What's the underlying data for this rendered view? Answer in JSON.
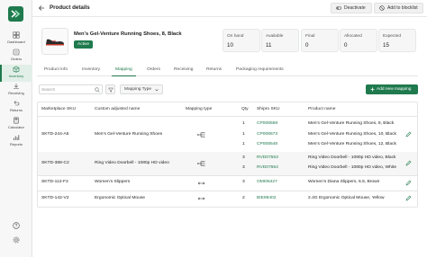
{
  "sidebar": {
    "items": [
      {
        "label": "Dashboard",
        "icon": "dashboard-icon"
      },
      {
        "label": "Orders",
        "icon": "orders-icon"
      },
      {
        "label": "Inventory",
        "icon": "inventory-icon"
      },
      {
        "label": "Receiving",
        "icon": "receiving-icon"
      },
      {
        "label": "Returns",
        "icon": "returns-icon"
      },
      {
        "label": "Calculator",
        "icon": "calculator-icon"
      },
      {
        "label": "Reports",
        "icon": "reports-icon"
      }
    ],
    "active": "Inventory"
  },
  "header": {
    "title": "Product details",
    "deactivate_label": "Deactivate",
    "blocklist_label": "Add to blocklist"
  },
  "product": {
    "name": "Men's Gel-Venture Running Shoes, 8, Black",
    "status": "Active"
  },
  "stats": [
    {
      "label": "On hand",
      "value": "10"
    },
    {
      "label": "Available",
      "value": "11"
    },
    {
      "label": "Final",
      "value": "0"
    },
    {
      "label": "Allocated",
      "value": "0"
    },
    {
      "label": "Expected",
      "value": "15"
    }
  ],
  "tabs": [
    "Product info",
    "Inventory",
    "Mapping",
    "Orders",
    "Receiving",
    "Returns",
    "Packaging requirements"
  ],
  "active_tab": "Mapping",
  "filters": {
    "search_placeholder": "Search",
    "mapping_type_label": "Mapping Type",
    "add_mapping_label": "Add new mapping"
  },
  "table": {
    "columns": [
      "Marketplace SKU",
      "Custom adjusted name",
      "Mapping type",
      "Qty",
      "Shipro SKU",
      "Product name"
    ],
    "groups": [
      {
        "marketplace_sku": "SKTD-244-A5",
        "custom_name": "Men's Gel-Venture Running Shoes",
        "mapping_type": "one-to-many",
        "lines": [
          {
            "qty": "1",
            "sku": "CP008558",
            "product": "Men's Gel-Venture Running Shoes, 8, Black"
          },
          {
            "qty": "1",
            "sku": "CP008573",
            "product": "Men's Gel-Venture Running Shoes, 10, Black"
          },
          {
            "qty": "1",
            "sku": "CP008548",
            "product": "Men's Gel-Venture Running Shoes, 12, Black"
          }
        ]
      },
      {
        "marketplace_sku": "SKTD-388-C2",
        "custom_name": "Ring Video Doorbell - 1080p HD video",
        "mapping_type": "one-to-many",
        "lines": [
          {
            "qty": "3",
            "sku": "RVD07553",
            "product": "Ring Video Doorbell - 1080p HD video, Black"
          },
          {
            "qty": "3",
            "sku": "RVD07554",
            "product": "Ring Video Doorbell - 1080p HD video, White"
          }
        ]
      },
      {
        "marketplace_sku": "SKTD-112-F2",
        "custom_name": "Women's Slippers",
        "mapping_type": "one-to-one",
        "lines": [
          {
            "qty": "3",
            "sku": "OMI05427",
            "product": "Women's Diana Slippers, 6.5, Brown"
          }
        ]
      },
      {
        "marketplace_sku": "SKTD-142-V2",
        "custom_name": "Ergonomic Optical Mouse",
        "mapping_type": "one-to-one",
        "lines": [
          {
            "qty": "2",
            "sku": "BIE98402",
            "product": "2.4G Ergonomic Optical Mouse, Yellow"
          }
        ]
      }
    ]
  },
  "colors": {
    "accent": "#1f7a4d",
    "active_tab_bg": "#e2efe8",
    "row_highlight": "#f5f6f5"
  }
}
